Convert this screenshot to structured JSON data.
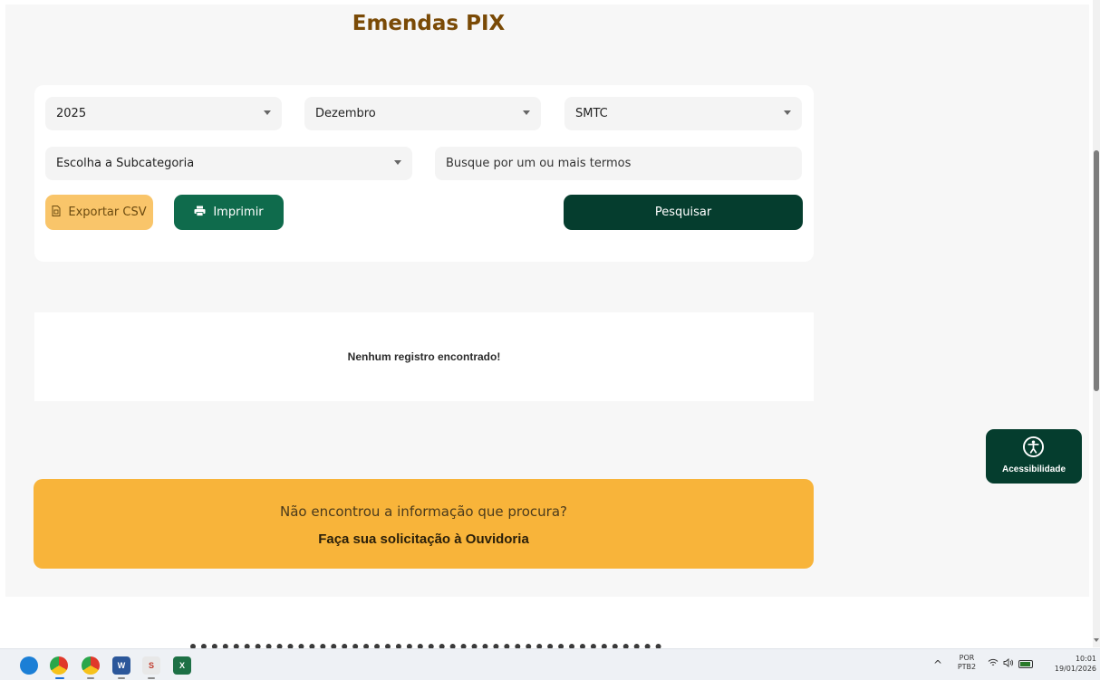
{
  "page": {
    "title": "Emendas PIX"
  },
  "filters": {
    "year": "2025",
    "month": "Dezembro",
    "organ": "SMTC",
    "subcategory_placeholder": "Escolha a Subcategoria",
    "search_placeholder": "Busque por um ou mais termos"
  },
  "actions": {
    "export_csv": "Exportar CSV",
    "print": "Imprimir",
    "search": "Pesquisar"
  },
  "results": {
    "empty_message": "Nenhum registro encontrado!"
  },
  "ombudsman": {
    "question": "Não encontrou a informação que procura?",
    "link": "Faça sua solicitação à Ouvidoria"
  },
  "accessibility": {
    "label": "Acessibilidade"
  },
  "taskbar": {
    "apps": [
      "edge-icon",
      "chrome-icon",
      "chrome-icon",
      "word-icon",
      "paint-icon",
      "excel-icon"
    ],
    "lang_top": "POR",
    "lang_bottom": "PTB2",
    "time": "10:01",
    "date": "19/01/2026"
  },
  "colors": {
    "title": "#7a4a06",
    "primary_dark": "#053d2e",
    "primary": "#0f6b4c",
    "csv": "#f9c56a",
    "ombudsman_bg": "#f8b43a"
  }
}
